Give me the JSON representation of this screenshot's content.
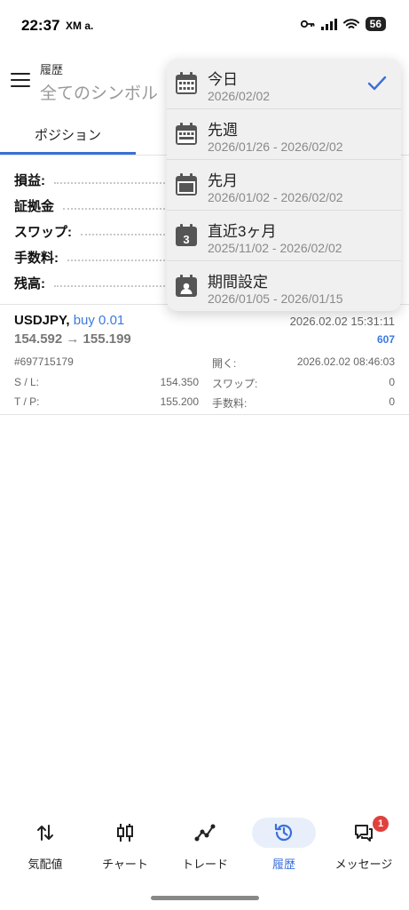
{
  "status_bar": {
    "time": "22:37",
    "apps": "XM a.",
    "battery": "56"
  },
  "header": {
    "title": "履歴",
    "subtitle": "全てのシンボル"
  },
  "tabs": {
    "positions": "ポジション"
  },
  "summary": {
    "profit": "損益:",
    "margin": "証拠金",
    "swap": "スワップ:",
    "commission": "手数料:",
    "balance": "残高:"
  },
  "position": {
    "symbol": "USDJPY,",
    "side": "buy 0.01",
    "close_time": "2026.02.02 15:31:11",
    "prices": "154.592 → 155.199",
    "profit": "607",
    "ticket": "#697715179",
    "open_label": "開く:",
    "open_time": "2026.02.02 08:46:03",
    "sl_label": "S / L:",
    "sl_value": "154.350",
    "swap_label": "スワップ:",
    "swap_value": "0",
    "tp_label": "T / P:",
    "tp_value": "155.200",
    "commission_label": "手数料:",
    "commission_value": "0"
  },
  "period_menu": {
    "items": [
      {
        "label": "今日",
        "range": "2026/02/02",
        "selected": true,
        "icon": "calendar-day-icon"
      },
      {
        "label": "先週",
        "range": "2026/01/26 - 2026/02/02",
        "selected": false,
        "icon": "calendar-week-icon"
      },
      {
        "label": "先月",
        "range": "2026/01/02 - 2026/02/02",
        "selected": false,
        "icon": "calendar-month-icon"
      },
      {
        "label": "直近3ヶ月",
        "range": "2025/11/02 - 2026/02/02",
        "selected": false,
        "icon": "calendar-3-icon"
      },
      {
        "label": "期間設定",
        "range": "2026/01/05 - 2026/01/15",
        "selected": false,
        "icon": "calendar-custom-icon"
      }
    ],
    "icon_badge_3": "3"
  },
  "bottom_nav": {
    "quotes": "気配値",
    "chart": "チャート",
    "trade": "トレード",
    "history": "履歴",
    "messages": "メッセージ",
    "messages_badge": "1"
  },
  "colors": {
    "accent": "#3b6fd8",
    "profit": "#3b7ae0",
    "badge": "#e0413d"
  }
}
